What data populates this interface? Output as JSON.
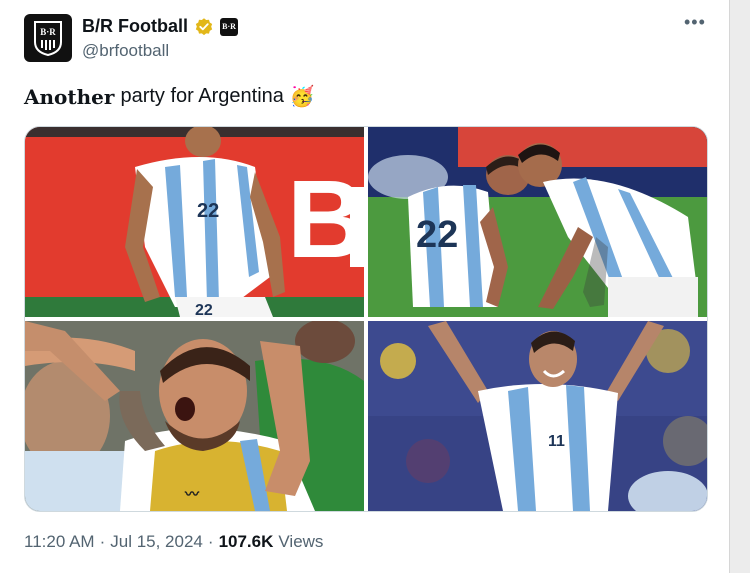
{
  "account": {
    "name": "B/R Football",
    "handle": "@brfootball",
    "avatar_text": "B·R",
    "affiliate_badge_text": "B·R"
  },
  "tweet": {
    "text_bold": "Another",
    "text_rest": "party for Argentina",
    "emoji": "🥳"
  },
  "media": {
    "photos": [
      {
        "jersey_number": "22",
        "banner_text": "B"
      },
      {
        "jersey_number": "22"
      },
      {},
      {}
    ]
  },
  "meta": {
    "time": "11:20 AM",
    "sep1": "·",
    "date": "Jul 15, 2024",
    "sep2": "·",
    "views_count": "107.6K",
    "views_label": "Views"
  },
  "colors": {
    "verified_gold": "#e2b719",
    "text_primary": "#0f1419",
    "text_secondary": "#536471",
    "argentina_blue": "#75aadb"
  }
}
